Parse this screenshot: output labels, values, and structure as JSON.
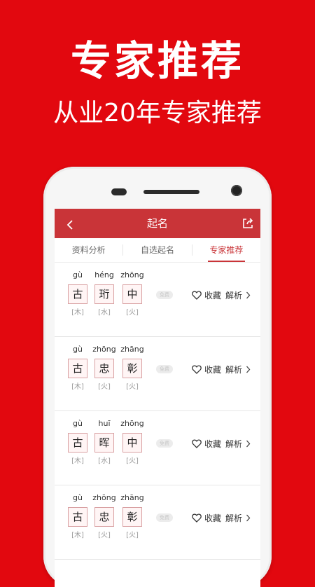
{
  "hero": {
    "title": "专家推荐",
    "subtitle": "从业20年专家推荐"
  },
  "colors": {
    "background": "#e2080f",
    "navbar": "#c93438",
    "accent": "#c93438"
  },
  "navbar": {
    "back_icon": "chevron-left-icon",
    "title": "起名",
    "share_icon": "share-icon"
  },
  "tabs": [
    {
      "label": "资料分析",
      "active": false
    },
    {
      "label": "自选起名",
      "active": false
    },
    {
      "label": "专家推荐",
      "active": true
    }
  ],
  "names": [
    {
      "chars": [
        {
          "pinyin": "gù",
          "char": "古",
          "element": "[木]"
        },
        {
          "pinyin": "héng",
          "char": "珩",
          "element": "[水]"
        },
        {
          "pinyin": "zhōng",
          "char": "中",
          "element": "[火]"
        }
      ],
      "badge": "免费",
      "favorite_label": "收藏",
      "analysis_label": "解析"
    },
    {
      "chars": [
        {
          "pinyin": "gù",
          "char": "古",
          "element": "[木]"
        },
        {
          "pinyin": "zhōng",
          "char": "忠",
          "element": "[火]"
        },
        {
          "pinyin": "zhāng",
          "char": "彰",
          "element": "[火]"
        }
      ],
      "badge": "免费",
      "favorite_label": "收藏",
      "analysis_label": "解析"
    },
    {
      "chars": [
        {
          "pinyin": "gù",
          "char": "古",
          "element": "[木]"
        },
        {
          "pinyin": "huī",
          "char": "晖",
          "element": "[水]"
        },
        {
          "pinyin": "zhōng",
          "char": "中",
          "element": "[火]"
        }
      ],
      "badge": "免费",
      "favorite_label": "收藏",
      "analysis_label": "解析"
    },
    {
      "chars": [
        {
          "pinyin": "gù",
          "char": "古",
          "element": "[木]"
        },
        {
          "pinyin": "zhōng",
          "char": "忠",
          "element": "[火]"
        },
        {
          "pinyin": "zhāng",
          "char": "彰",
          "element": "[火]"
        }
      ],
      "badge": "免费",
      "favorite_label": "收藏",
      "analysis_label": "解析"
    }
  ]
}
